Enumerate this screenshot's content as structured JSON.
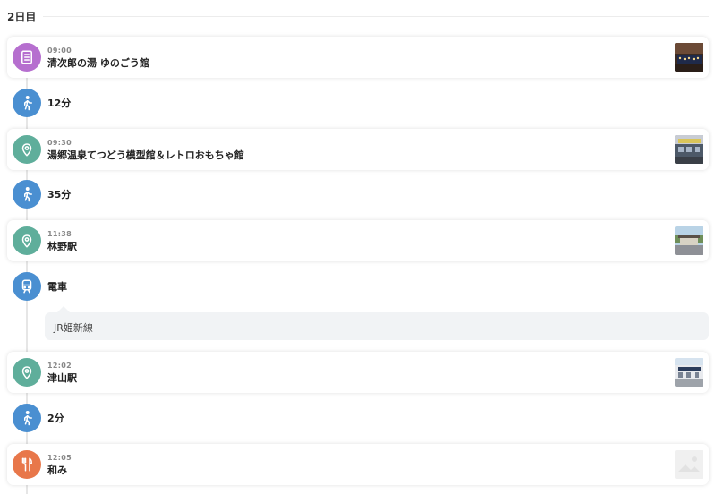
{
  "day": {
    "label": "2日目"
  },
  "stops": [
    {
      "time": "09:00",
      "name": "清次郎の湯 ゆのごう館",
      "icon": "building-icon",
      "color": "#b66fcf"
    },
    {
      "time": "09:30",
      "name": "湯郷温泉てつどう模型館＆レトロおもちゃ館",
      "icon": "map-pin-icon",
      "color": "#5fae9b"
    },
    {
      "time": "11:38",
      "name": "林野駅",
      "icon": "map-pin-icon",
      "color": "#5fae9b"
    },
    {
      "time": "12:02",
      "name": "津山駅",
      "icon": "map-pin-icon",
      "color": "#5fae9b"
    },
    {
      "time": "12:05",
      "name": "和み",
      "icon": "fork-knife-icon",
      "color": "#e8774a"
    }
  ],
  "moves": [
    {
      "mode": "walk",
      "label": "12分",
      "icon": "walking-icon"
    },
    {
      "mode": "walk",
      "label": "35分",
      "icon": "walking-icon"
    },
    {
      "mode": "train",
      "label": "電車",
      "icon": "train-icon",
      "note": "JR姫新線"
    },
    {
      "mode": "walk",
      "label": "2分",
      "icon": "walking-icon"
    }
  ]
}
